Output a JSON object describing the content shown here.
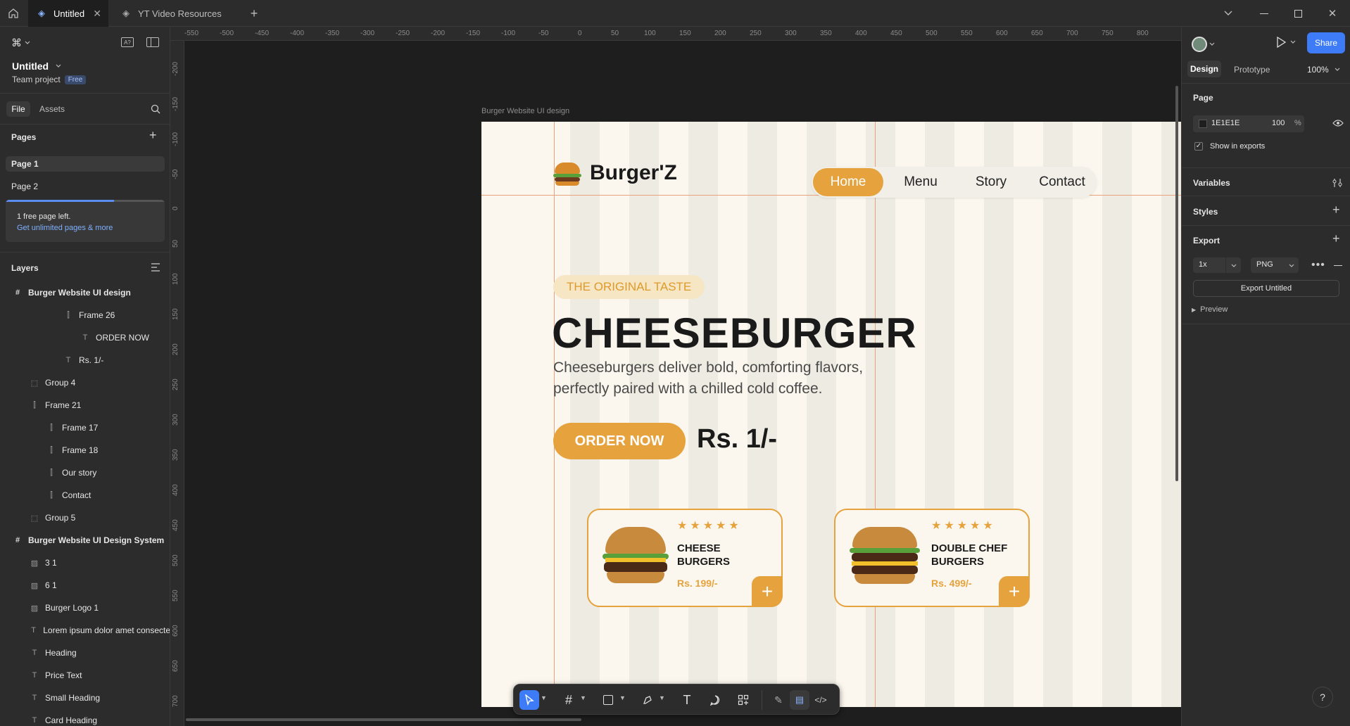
{
  "tabs": [
    {
      "label": "Untitled",
      "active": true
    },
    {
      "label": "YT Video Resources",
      "active": false
    }
  ],
  "file": {
    "name": "Untitled",
    "project": "Team project",
    "plan_badge": "Free"
  },
  "left_tabs": {
    "file": "File",
    "assets": "Assets"
  },
  "pages": {
    "heading": "Pages",
    "items": [
      "Page 1",
      "Page 2"
    ],
    "notice_title": "1 free page left.",
    "notice_link": "Get unlimited pages & more",
    "usage_fraction": 0.68
  },
  "layers": {
    "heading": "Layers",
    "items": [
      {
        "label": "Burger Website UI design",
        "icon": "frame-icon",
        "level": 0,
        "bold": true
      },
      {
        "label": "Frame 26",
        "icon": "autolayout-icon",
        "level": 3
      },
      {
        "label": "ORDER NOW",
        "icon": "text-icon",
        "level": 4
      },
      {
        "label": "Rs. 1/-",
        "icon": "text-icon",
        "level": 3
      },
      {
        "label": "Group 4",
        "icon": "group-icon",
        "level": 1
      },
      {
        "label": "Frame 21",
        "icon": "autolayout-icon",
        "level": 1
      },
      {
        "label": "Frame 17",
        "icon": "autolayout-icon",
        "level": 2
      },
      {
        "label": "Frame 18",
        "icon": "autolayout-icon",
        "level": 2
      },
      {
        "label": "Our story",
        "icon": "autolayout-icon",
        "level": 2
      },
      {
        "label": "Contact",
        "icon": "autolayout-icon",
        "level": 2
      },
      {
        "label": "Group 5",
        "icon": "group-icon",
        "level": 1
      },
      {
        "label": "Burger Website UI Design System",
        "icon": "frame-icon",
        "level": 0,
        "bold": true
      },
      {
        "label": "3 1",
        "icon": "image-icon",
        "level": 1
      },
      {
        "label": "6 1",
        "icon": "image-icon",
        "level": 1
      },
      {
        "label": "Burger Logo 1",
        "icon": "image-icon",
        "level": 1
      },
      {
        "label": "Lorem ipsum dolor amet consecte",
        "icon": "text-icon",
        "level": 1
      },
      {
        "label": "Heading",
        "icon": "text-icon",
        "level": 1
      },
      {
        "label": "Price Text",
        "icon": "text-icon",
        "level": 1
      },
      {
        "label": "Small Heading",
        "icon": "text-icon",
        "level": 1
      },
      {
        "label": "Card Heading",
        "icon": "text-icon",
        "level": 1
      }
    ]
  },
  "rulers": {
    "top": [
      "-550",
      "-500",
      "-450",
      "-400",
      "-350",
      "-300",
      "-250",
      "-200",
      "-150",
      "-100",
      "-50",
      "0",
      "50",
      "100",
      "150",
      "200",
      "250",
      "300",
      "350",
      "400",
      "450",
      "500",
      "550",
      "600",
      "650",
      "700",
      "750",
      "800"
    ],
    "left": [
      "-200",
      "-150",
      "-100",
      "-50",
      "0",
      "50",
      "100",
      "150",
      "200",
      "250",
      "300",
      "350",
      "400",
      "450",
      "500",
      "550",
      "600",
      "650",
      "700"
    ]
  },
  "right_panel": {
    "share": "Share",
    "tabs": {
      "design": "Design",
      "prototype": "Prototype"
    },
    "zoom": "100%",
    "page_heading": "Page",
    "page_color": "1E1E1E",
    "page_opacity": "100",
    "percent": "%",
    "show_in_exports": "Show in exports",
    "variables": "Variables",
    "styles": "Styles",
    "export_heading": "Export",
    "export_scale": "1x",
    "export_format": "PNG",
    "export_button": "Export Untitled",
    "preview": "Preview"
  },
  "canvas": {
    "frame_label": "Burger Website UI design",
    "brand": "Burger'Z",
    "nav": [
      "Home",
      "Menu",
      "Story",
      "Contact"
    ],
    "tagline": "THE ORIGINAL TASTE",
    "headline": "CHEESEBURGER",
    "description_line1": "Cheeseburgers deliver bold, comforting flavors,",
    "description_line2": "perfectly paired with a chilled cold coffee.",
    "order_button": "ORDER NOW",
    "price": "Rs. 1/-",
    "cards": [
      {
        "title_line1": "CHEESE",
        "title_line2": "BURGERS",
        "price": "Rs. 199/-",
        "stars": "★★★★★"
      },
      {
        "title_line1": "DOUBLE CHEF",
        "title_line2": "BURGERS",
        "price": "Rs. 499/-",
        "stars": "★★★★★"
      }
    ]
  },
  "colors": {
    "accent": "#E6A23C",
    "figma_blue": "#3D7BF7",
    "canvas_bg": "#1E1E1E",
    "frame_bg": "#FBF7EE"
  },
  "help": "?"
}
